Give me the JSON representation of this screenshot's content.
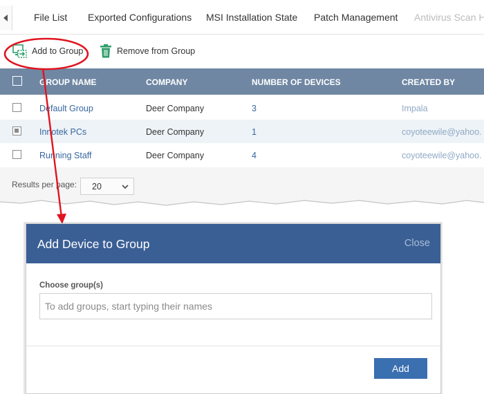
{
  "tabs": [
    {
      "label": "File List",
      "disabled": false
    },
    {
      "label": "Exported Configurations",
      "disabled": false
    },
    {
      "label": "MSI Installation State",
      "disabled": false
    },
    {
      "label": "Patch Management",
      "disabled": false
    },
    {
      "label": "Antivirus Scan Hi",
      "disabled": true
    }
  ],
  "toolbar": {
    "add_label": "Add to Group",
    "remove_label": "Remove from Group"
  },
  "grid": {
    "columns": [
      "GROUP NAME",
      "COMPANY",
      "NUMBER OF DEVICES",
      "CREATED BY"
    ],
    "rows": [
      {
        "checked": false,
        "group": "Default Group",
        "company": "Deer Company",
        "devices": "3",
        "created_by": "Impala"
      },
      {
        "checked": true,
        "group": "Innotek PCs",
        "company": "Deer Company",
        "devices": "1",
        "created_by": "coyoteewile@yahoo."
      },
      {
        "checked": false,
        "group": "Running Staff",
        "company": "Deer Company",
        "devices": "4",
        "created_by": "coyoteewile@yahoo."
      }
    ]
  },
  "footer": {
    "results_label": "Results per page:",
    "per_page": "20"
  },
  "dialog": {
    "title": "Add Device to Group",
    "close_label": "Close",
    "choose_label": "Choose group(s)",
    "input_placeholder": "To add groups, start typing their names",
    "input_value": "",
    "add_label": "Add"
  },
  "colors": {
    "grid_header": "#6f87a3",
    "dialog_header": "#3a5f95",
    "primary_button": "#3a6fb0",
    "link": "#3766a0",
    "annotation": "#e0141e",
    "icon_green": "#2e9e6a"
  }
}
